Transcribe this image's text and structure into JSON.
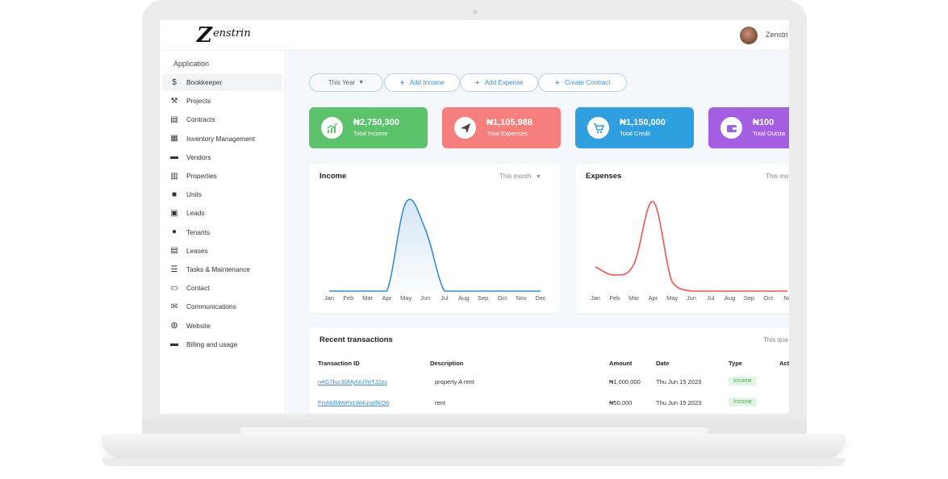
{
  "brand": {
    "logo_initial": "Z",
    "logo_rest": "enstrin"
  },
  "user": {
    "name": "Zenstri"
  },
  "sidebar": {
    "heading": "Application",
    "items": [
      {
        "label": "Bookkeeper",
        "icon": "dollar-icon",
        "glyph": "$",
        "active": true
      },
      {
        "label": "Projects",
        "icon": "tools-icon",
        "glyph": "⚒"
      },
      {
        "label": "Contracts",
        "icon": "document-icon",
        "glyph": "▤"
      },
      {
        "label": "Inventory Management",
        "icon": "archive-icon",
        "glyph": "▦"
      },
      {
        "label": "Vendors",
        "icon": "briefcase-icon",
        "glyph": "▬"
      },
      {
        "label": "Properties",
        "icon": "building-icon",
        "glyph": "▥"
      },
      {
        "label": "Units",
        "icon": "boxes-icon",
        "glyph": "■"
      },
      {
        "label": "Leads",
        "icon": "contact-icon",
        "glyph": "▣"
      },
      {
        "label": "Tenants",
        "icon": "user-icon",
        "glyph": "●"
      },
      {
        "label": "Leases",
        "icon": "file-icon",
        "glyph": "▤"
      },
      {
        "label": "Tasks & Maintenance",
        "icon": "clipboard-icon",
        "glyph": "☰"
      },
      {
        "label": "Contact",
        "icon": "id-card-icon",
        "glyph": "▭"
      },
      {
        "label": "Communications",
        "icon": "envelope-icon",
        "glyph": "✉"
      },
      {
        "label": "Website",
        "icon": "globe-icon",
        "glyph": "◍"
      },
      {
        "label": "Billing and usage",
        "icon": "credit-card-icon",
        "glyph": "▬"
      }
    ]
  },
  "toolbar": {
    "period": "This Year",
    "add_income": "Add Income",
    "add_expense": "Add Expense",
    "create_contract": "Create Contract"
  },
  "cards": [
    {
      "amount": "₦2,750,300",
      "label": "Total Income",
      "color": "#5cc26b",
      "icon": "trending-up-icon"
    },
    {
      "amount": "₦1,105,988",
      "label": "Total Expenses",
      "color": "#f47f7c",
      "icon": "paper-plane-icon"
    },
    {
      "amount": "₦1,150,000",
      "label": "Total Credit",
      "color": "#2f9fe0",
      "icon": "cart-icon"
    },
    {
      "amount": "₦100",
      "label": "Total Outsta",
      "color": "#a45ee2",
      "icon": "wallet-icon"
    }
  ],
  "income_panel": {
    "title": "Income",
    "filter": "This month"
  },
  "expenses_panel": {
    "title": "Expenses",
    "filter": "This mo"
  },
  "chart_data": [
    {
      "type": "area",
      "title": "Income",
      "categories": [
        "Jan",
        "Feb",
        "Mar",
        "Apr",
        "May",
        "Jun",
        "Jul",
        "Aug",
        "Sep",
        "Oct",
        "Nov",
        "Dec"
      ],
      "series": [
        {
          "values": [
            0,
            0,
            0,
            0,
            1.0,
            0.7,
            0,
            0,
            0,
            0,
            0,
            0
          ]
        }
      ],
      "color": "#3c8dd1"
    },
    {
      "type": "line",
      "title": "Expenses",
      "categories": [
        "Jan",
        "Feb",
        "Mar",
        "Apr",
        "May",
        "Jun",
        "Jul",
        "Aug",
        "Sep",
        "Oct",
        "No"
      ],
      "series": [
        {
          "values": [
            0.27,
            0.18,
            0.3,
            1.0,
            0.1,
            0,
            0,
            0,
            0,
            0,
            0
          ]
        }
      ],
      "color": "#ef5350"
    }
  ],
  "transactions": {
    "title": "Recent transactions",
    "filter": "This qua",
    "columns": [
      "Transaction ID",
      "Description",
      "Amount",
      "Date",
      "Type",
      "Act"
    ],
    "rows": [
      {
        "id": "n4G7fuc30MyNUYeTJ2zs",
        "description": "property A rent",
        "amount": "₦1,000,000",
        "date": "Thu Jun 15 2023",
        "type": "Income"
      },
      {
        "id": "FrsMdMWPxLW4uraIfKO6",
        "description": "rent",
        "amount": "₦50,000",
        "date": "Thu Jun 15 2023",
        "type": "Income"
      }
    ]
  }
}
